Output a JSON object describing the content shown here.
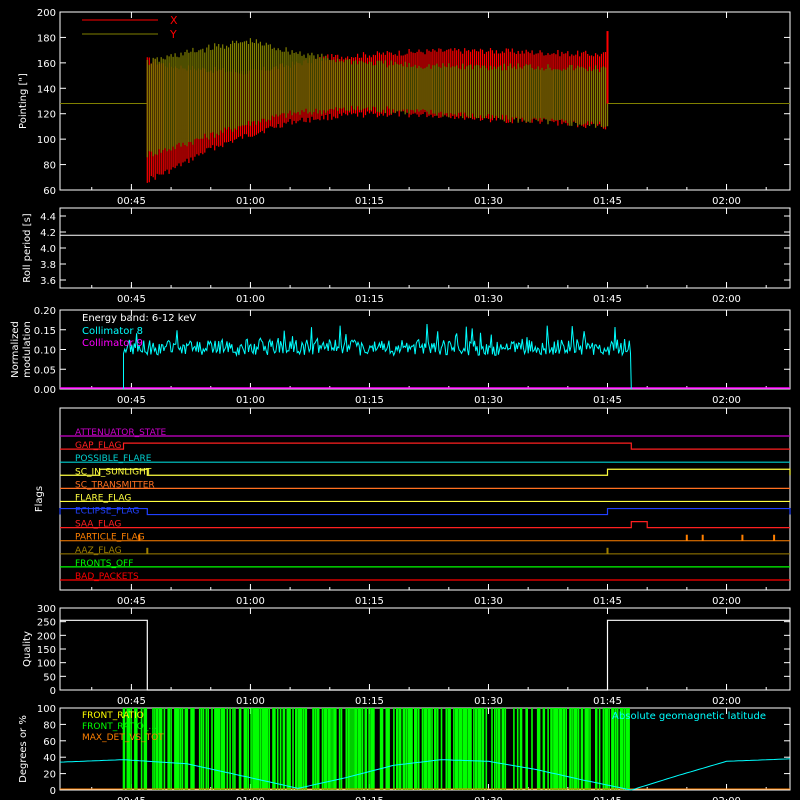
{
  "figure": {
    "background": "#000000",
    "axis_color": "#ffffff",
    "time_ticks": [
      "00:45",
      "01:00",
      "01:15",
      "01:30",
      "01:45",
      "02:00"
    ]
  },
  "chart_data": [
    {
      "id": "pointing",
      "type": "line",
      "ylabel": "Pointing [\"]",
      "ylim": [
        60,
        200
      ],
      "yticks": [
        "60",
        "80",
        "100",
        "120",
        "140",
        "160",
        "180",
        "200"
      ],
      "xlim": [
        "00:36",
        "02:08"
      ],
      "legend": [
        {
          "label": "X",
          "color": "#ff0000"
        },
        {
          "label": "Y",
          "color": "#808000"
        }
      ],
      "series": [
        {
          "name": "X",
          "color": "#ff0000",
          "envelope_x": [
            "00:47",
            "00:50",
            "00:55",
            "01:00",
            "01:05",
            "01:10",
            "01:15",
            "01:20",
            "01:25",
            "01:30",
            "01:35",
            "01:40",
            "01:45"
          ],
          "upper": [
            160,
            155,
            152,
            150,
            156,
            162,
            164,
            166,
            167,
            167,
            166,
            165,
            164
          ],
          "lower": [
            70,
            78,
            95,
            106,
            116,
            120,
            122,
            122,
            121,
            118,
            117,
            115,
            112
          ]
        },
        {
          "name": "Y",
          "color": "#808000",
          "envelope_x": [
            "00:47",
            "00:50",
            "00:55",
            "01:00",
            "01:05",
            "01:10",
            "01:15",
            "01:20",
            "01:25",
            "01:30",
            "01:35",
            "01:40",
            "01:45"
          ],
          "upper": [
            163,
            168,
            175,
            180,
            172,
            166,
            163,
            161,
            160,
            160,
            160,
            159,
            158
          ],
          "lower": [
            85,
            90,
            100,
            110,
            117,
            120,
            121,
            119,
            117,
            114,
            112,
            110,
            108
          ]
        }
      ],
      "baseline": 128,
      "spike": {
        "x": "01:45",
        "value": 185
      }
    },
    {
      "id": "roll",
      "type": "line",
      "ylabel": "Roll period [s]",
      "ylim": [
        3.5,
        4.5
      ],
      "yticks": [
        "3.6",
        "3.8",
        "4.0",
        "4.2",
        "4.4"
      ],
      "series": [
        {
          "name": "",
          "color": "#ffffff",
          "x": [
            "00:36",
            "02:08"
          ],
          "y": [
            4.16,
            4.16
          ]
        }
      ]
    },
    {
      "id": "modulation",
      "type": "line",
      "ylabel": "Normalized modulation",
      "ylim": [
        0,
        0.2
      ],
      "yticks": [
        "0.00",
        "0.05",
        "0.10",
        "0.15",
        "0.20"
      ],
      "annotation": "Energy band: 6-12 keV",
      "legend": [
        {
          "label": "Collimator 8",
          "color": "#00ffff"
        },
        {
          "label": "Collimator 9",
          "color": "#ff00ff"
        }
      ],
      "series": [
        {
          "name": "Collimator 8",
          "color": "#00ffff",
          "x_range": [
            "00:44",
            "01:48"
          ],
          "mean": 0.105,
          "noise": 0.02,
          "spikes": 0.165
        },
        {
          "name": "Collimator 9",
          "color": "#ff00ff",
          "x": [
            "00:36",
            "02:08"
          ],
          "y": [
            0,
            0
          ]
        }
      ]
    },
    {
      "id": "flags",
      "type": "line",
      "ylabel": "Flags",
      "flags": [
        {
          "name": "ATTENUATOR_STATE",
          "color": "#cc00cc",
          "steps": []
        },
        {
          "name": "GAP_FLAG",
          "color": "#ff2020",
          "steps": [
            [
              "00:44",
              "01:48"
            ]
          ]
        },
        {
          "name": "POSSIBLE_FLARE",
          "color": "#00d0d0",
          "steps": []
        },
        {
          "name": "SC_IN_SUNLIGHT",
          "color": "#ffff40",
          "steps": [
            [
              "00:41",
              "00:47"
            ],
            [
              "01:45",
              "02:08"
            ]
          ]
        },
        {
          "name": "SC_TRANSMITTER",
          "color": "#ff7020",
          "steps": []
        },
        {
          "name": "FLARE_FLAG",
          "color": "#ffff40",
          "steps": []
        },
        {
          "name": "ECLIPSE_FLAG",
          "color": "#2040ff",
          "steps": [
            [
              "00:36",
              "00:47"
            ],
            [
              "01:45",
              "02:08"
            ]
          ]
        },
        {
          "name": "SAA_FLAG",
          "color": "#ff2020",
          "steps": [
            [
              "01:48",
              "01:50"
            ]
          ]
        },
        {
          "name": "PARTICLE_FLAG",
          "color": "#ff8000",
          "ticks": [
            "00:46",
            "01:55",
            "01:57",
            "02:02",
            "02:06"
          ]
        },
        {
          "name": "AAZ_FLAG",
          "color": "#a08000",
          "ticks": [
            "00:47",
            "01:45"
          ]
        },
        {
          "name": "FRONTS_OFF",
          "color": "#00ff00",
          "steps": []
        },
        {
          "name": "BAD_PACKETS",
          "color": "#ff0000",
          "steps": []
        }
      ]
    },
    {
      "id": "quality",
      "type": "line",
      "ylabel": "Quality",
      "ylim": [
        0,
        300
      ],
      "yticks": [
        "0",
        "50",
        "100",
        "150",
        "200",
        "250",
        "300"
      ],
      "series": [
        {
          "name": "",
          "color": "#ffffff",
          "x": [
            "00:36",
            "00:47",
            "00:47",
            "01:45",
            "01:45",
            "01:45",
            "02:08"
          ],
          "y": [
            255,
            255,
            0,
            0,
            30,
            255,
            255
          ]
        }
      ]
    },
    {
      "id": "geomag",
      "type": "line",
      "ylabel": "Degrees or %",
      "ylim": [
        0,
        100
      ],
      "yticks": [
        "0",
        "20",
        "40",
        "60",
        "80",
        "100"
      ],
      "legend": [
        {
          "label": "FRONT_RATIO",
          "color": "#ffff00"
        },
        {
          "label": "FRONT_RATIO_...",
          "color": "#00ff00"
        },
        {
          "label": "MAX_DET_VS_TOT",
          "color": "#ff8000"
        }
      ],
      "right_legend": {
        "label": "Absolute geomagnetic latitude",
        "color": "#00ffff"
      },
      "series": [
        {
          "name": "FRONT_RATIO_...",
          "color": "#00ff00",
          "x_range": [
            "00:44",
            "01:48"
          ],
          "value": 100
        },
        {
          "name": "Absolute geomagnetic latitude",
          "color": "#00ffff",
          "x": [
            "00:36",
            "00:44",
            "00:52",
            "01:00",
            "01:06",
            "01:12",
            "01:18",
            "01:24",
            "01:30",
            "01:36",
            "01:42",
            "01:48",
            "01:54",
            "02:00",
            "02:08"
          ],
          "y": [
            34,
            37,
            32,
            15,
            2,
            15,
            30,
            37,
            35,
            25,
            12,
            0,
            18,
            35,
            38
          ]
        }
      ]
    }
  ]
}
